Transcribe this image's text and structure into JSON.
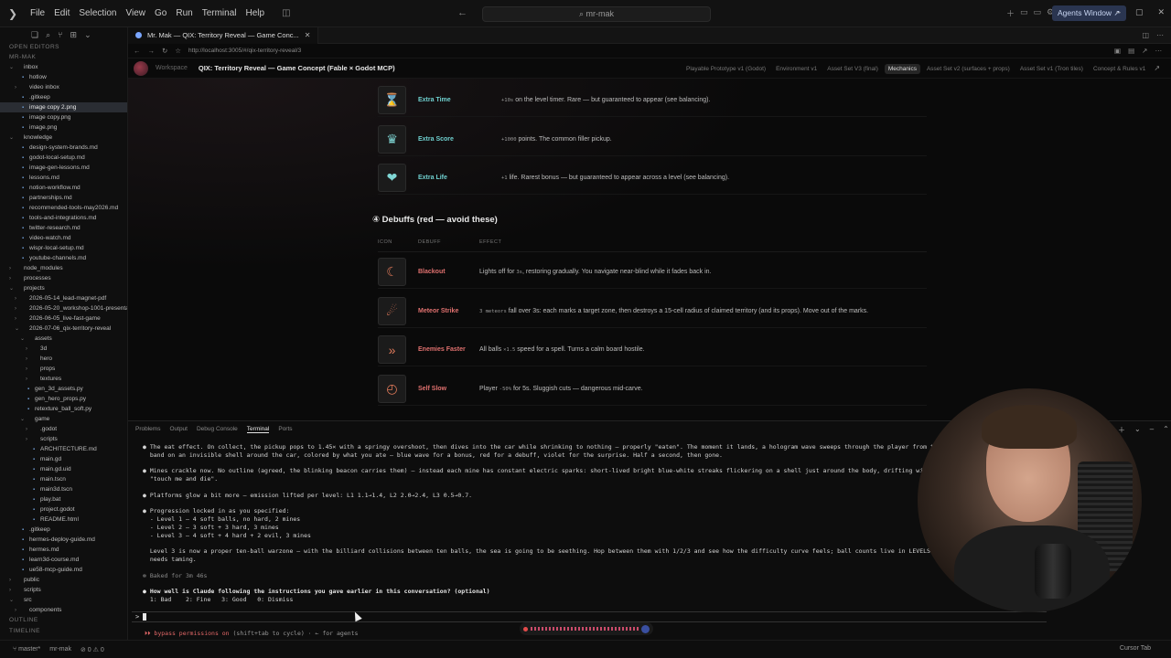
{
  "menubar": {
    "items": [
      "File",
      "Edit",
      "Selection",
      "View",
      "Go",
      "Run",
      "Terminal",
      "Help"
    ],
    "search": "mr-mak",
    "agents_window": "Agents Window"
  },
  "sidebar": {
    "open_editors": "OPEN EDITORS",
    "root": "MR-MAK",
    "tree": [
      {
        "label": "inbox",
        "depth": 1,
        "kind": "folder-open"
      },
      {
        "label": "hotlow",
        "depth": 2,
        "kind": "file"
      },
      {
        "label": "video inbox",
        "depth": 2,
        "kind": "folder"
      },
      {
        "label": ".gitkeep",
        "depth": 2,
        "kind": "file"
      },
      {
        "label": "image copy 2.png",
        "depth": 2,
        "kind": "file",
        "selected": true
      },
      {
        "label": "image copy.png",
        "depth": 2,
        "kind": "file"
      },
      {
        "label": "image.png",
        "depth": 2,
        "kind": "file"
      },
      {
        "label": "knowledge",
        "depth": 1,
        "kind": "folder-open"
      },
      {
        "label": "design-system-brands.md",
        "depth": 2,
        "kind": "file"
      },
      {
        "label": "godot-local-setup.md",
        "depth": 2,
        "kind": "file"
      },
      {
        "label": "image-gen-lessons.md",
        "depth": 2,
        "kind": "file"
      },
      {
        "label": "lessons.md",
        "depth": 2,
        "kind": "file"
      },
      {
        "label": "notion-workflow.md",
        "depth": 2,
        "kind": "file"
      },
      {
        "label": "partnerships.md",
        "depth": 2,
        "kind": "file"
      },
      {
        "label": "recommended-tools-may2026.md",
        "depth": 2,
        "kind": "file"
      },
      {
        "label": "tools-and-integrations.md",
        "depth": 2,
        "kind": "file"
      },
      {
        "label": "twitter-research.md",
        "depth": 2,
        "kind": "file"
      },
      {
        "label": "video-watch.md",
        "depth": 2,
        "kind": "file"
      },
      {
        "label": "wispr-local-setup.md",
        "depth": 2,
        "kind": "file"
      },
      {
        "label": "youtube-channels.md",
        "depth": 2,
        "kind": "file"
      },
      {
        "label": "node_modules",
        "depth": 1,
        "kind": "folder"
      },
      {
        "label": "processes",
        "depth": 1,
        "kind": "folder"
      },
      {
        "label": "projects",
        "depth": 1,
        "kind": "folder-open"
      },
      {
        "label": "2026-05-14_lead-magnet-pdf",
        "depth": 2,
        "kind": "folder"
      },
      {
        "label": "2026-05-20_workshop-1001-presentati...",
        "depth": 2,
        "kind": "folder"
      },
      {
        "label": "2026-06-05_live-fast-game",
        "depth": 2,
        "kind": "folder"
      },
      {
        "label": "2026-07-06_qix-territory-reveal",
        "depth": 2,
        "kind": "folder-open"
      },
      {
        "label": "assets",
        "depth": 3,
        "kind": "folder-open"
      },
      {
        "label": "3d",
        "depth": 4,
        "kind": "folder"
      },
      {
        "label": "hero",
        "depth": 4,
        "kind": "folder"
      },
      {
        "label": "props",
        "depth": 4,
        "kind": "folder"
      },
      {
        "label": "textures",
        "depth": 4,
        "kind": "folder"
      },
      {
        "label": "gen_3d_assets.py",
        "depth": 3,
        "kind": "file"
      },
      {
        "label": "gen_hero_props.py",
        "depth": 3,
        "kind": "file"
      },
      {
        "label": "retexture_ball_soft.py",
        "depth": 3,
        "kind": "file"
      },
      {
        "label": "game",
        "depth": 3,
        "kind": "folder-open"
      },
      {
        "label": ".godot",
        "depth": 4,
        "kind": "folder"
      },
      {
        "label": "scripts",
        "depth": 4,
        "kind": "folder"
      },
      {
        "label": "ARCHITECTURE.md",
        "depth": 4,
        "kind": "file"
      },
      {
        "label": "main.gd",
        "depth": 4,
        "kind": "file"
      },
      {
        "label": "main.gd.uid",
        "depth": 4,
        "kind": "file"
      },
      {
        "label": "main.tscn",
        "depth": 4,
        "kind": "file"
      },
      {
        "label": "main3d.tscn",
        "depth": 4,
        "kind": "file"
      },
      {
        "label": "play.bat",
        "depth": 4,
        "kind": "file"
      },
      {
        "label": "project.godot",
        "depth": 4,
        "kind": "file"
      },
      {
        "label": "README.html",
        "depth": 4,
        "kind": "file"
      },
      {
        "label": ".gitkeep",
        "depth": 2,
        "kind": "file"
      },
      {
        "label": "hermes-deploy-guide.md",
        "depth": 2,
        "kind": "file"
      },
      {
        "label": "hermes.md",
        "depth": 2,
        "kind": "file"
      },
      {
        "label": "learn3d-course.md",
        "depth": 2,
        "kind": "file"
      },
      {
        "label": "ue58-mcp-guide.md",
        "depth": 2,
        "kind": "file"
      },
      {
        "label": "public",
        "depth": 1,
        "kind": "folder"
      },
      {
        "label": "scripts",
        "depth": 1,
        "kind": "folder"
      },
      {
        "label": "src",
        "depth": 1,
        "kind": "folder-open"
      },
      {
        "label": "components",
        "depth": 2,
        "kind": "folder"
      }
    ],
    "outline": "OUTLINE",
    "timeline": "TIMELINE"
  },
  "statusbar": {
    "branch": "master*",
    "workspace": "mr-mak",
    "problems": "⊘ 0 ⚠ 0",
    "cursor_tab": "Cursor Tab"
  },
  "editor": {
    "tab_title": "Mr. Mak — QIX: Territory Reveal — Game Conc...",
    "url": "http://localhost:3005/#/qix-territory-reveal/3",
    "workspace": "Workspace",
    "doc_title": "QIX: Territory Reveal — Game Concept (Fable × Godot MCP)",
    "doc_tabs": [
      "Playable Prototype v1 (Godot)",
      "Environment v1",
      "Asset Set V3 (final)",
      "Mechanics",
      "Asset Set v2 (surfaces + props)",
      "Asset Set v1 (Tron tiles)",
      "Concept & Rules v1"
    ],
    "active_doc_tab": "Mechanics",
    "buffs": [
      {
        "name": "Extra Time",
        "code": "+10s",
        "rest": " on the level timer. Rare — but guaranteed to appear (see balancing).",
        "icon": "⌛"
      },
      {
        "name": "Extra Score",
        "code": "+1000",
        "rest": " points. The common filler pickup.",
        "icon": "♛"
      },
      {
        "name": "Extra Life",
        "code": "+1",
        "rest": " life. Rarest bonus — but guaranteed to appear across a level (see balancing).",
        "icon": "❤"
      }
    ],
    "debuff_heading": "④ Debuffs (red — avoid these)",
    "debuff_columns": [
      "ICON",
      "DEBUFF",
      "EFFECT"
    ],
    "debuffs": [
      {
        "name": "Blackout",
        "pre": "Lights off for ",
        "code": "3s",
        "rest": ", restoring gradually. You navigate near-blind while it fades back in.",
        "icon": "☾"
      },
      {
        "name": "Meteor Strike",
        "pre": "",
        "code": "3 meteors",
        "rest": " fall over 3s: each marks a target zone, then destroys a 15-cell radius of claimed territory (and its props). Move out of the marks.",
        "icon": "☄"
      },
      {
        "name": "Enemies Faster",
        "pre": "All balls ",
        "code": "×1.5",
        "rest": " speed for a spell. Turns a calm board hostile.",
        "icon": "»"
      },
      {
        "name": "Self Slow",
        "pre": "Player ",
        "code": "-50%",
        "rest": " for 5s. Sluggish cuts — dangerous mid-carve.",
        "icon": "◴"
      }
    ]
  },
  "panel": {
    "tabs": [
      "Problems",
      "Output",
      "Debug Console",
      "Terminal",
      "Ports"
    ],
    "active_tab": "Terminal",
    "lines": [
      "● The eat effect. On collect, the pickup pops to 1.45× with a springy overshoot, then dives into the car while shrinking to nothing — properly \"eaten\". The moment it lands, a hologram wave sweeps through the player from top",
      "  band on an invisible shell around the car, colored by what you ate — blue wave for a bonus, red for a debuff, violet for the surprise. Half a second, then gone.",
      "",
      "● Mines crackle now. No outline (agreed, the blinking beacon carries them) — instead each mine has constant electric sparks: short-lived bright blue-white streaks flickering on a shell just around the body, drifting with",
      "  \"touch me and die\".",
      "",
      "● Platforms glow a bit more — emission lifted per level: L1 1.1→1.4, L2 2.0→2.4, L3 0.5→0.7.",
      "",
      "● Progression locked in as you specified:",
      "  - Level 1 — 4 soft balls, no hard, 2 mines",
      "  - Level 2 — 3 soft + 3 hard, 3 mines",
      "  - Level 3 — 4 soft + 4 hard + 2 evil, 3 mines",
      "",
      "  Level 3 is now a proper ten-ball warzone — with the billiard collisions between ten balls, the sea is going to be seething. Hop between them with 1/2/3 and see how the difficulty curve feels; ball counts live in LEVELS in",
      "  needs taming.",
      "",
      "✻ Baked for 3m 46s",
      "",
      "● How well is Claude following the instructions you gave earlier in this conversation? (optional)",
      "  1: Bad    2: Fine   3: Good   0: Dismiss"
    ],
    "prompt": ">",
    "bypass_red": "⏵⏵ bypass permissions on",
    "bypass_rest": " (shift+tab to cycle) · ← for agents"
  }
}
